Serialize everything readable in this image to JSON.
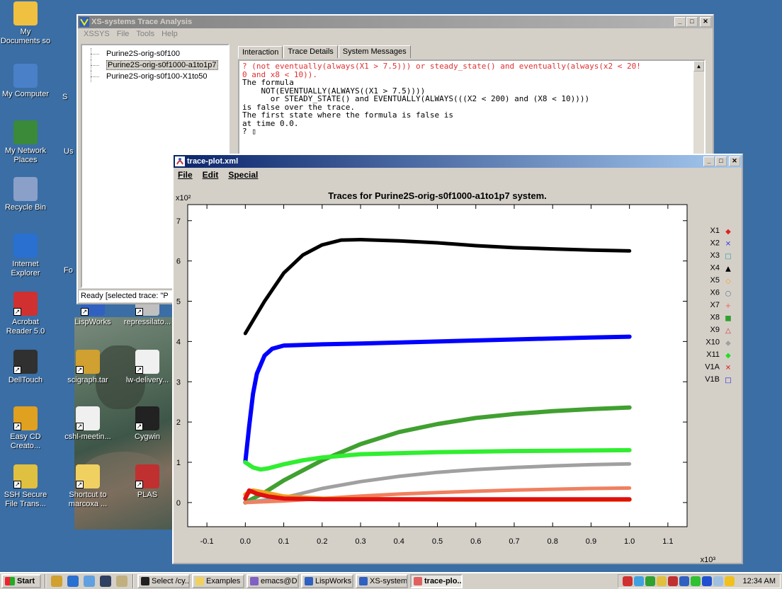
{
  "desktop": {
    "icons": [
      {
        "label": "My Documents so",
        "color": "#f0c040"
      },
      {
        "label": "My Computer",
        "color": "#4a80c8"
      },
      {
        "label": "My Network Places",
        "color": "#3a8a3a"
      },
      {
        "label": "Recycle Bin",
        "color": "#8aa0c8"
      },
      {
        "label": "Internet Explorer",
        "color": "#2a70d0"
      },
      {
        "label": "Acrobat Reader 5.0",
        "color": "#d03030"
      },
      {
        "label": "DellTouch",
        "color": "#303030"
      },
      {
        "label": "Easy CD Creato...",
        "color": "#e0a020"
      },
      {
        "label": "SSH Secure File Trans...",
        "color": "#e0c040"
      },
      {
        "label": "LispWorks",
        "color": "#3060c0"
      },
      {
        "label": "repressilato...",
        "color": "#c0c0c0"
      },
      {
        "label": "scigraph.tar",
        "color": "#d0a030"
      },
      {
        "label": "lw-delivery...",
        "color": "#f0f0f0"
      },
      {
        "label": "cshl-meetin...",
        "color": "#f0f0f0"
      },
      {
        "label": "Cygwin",
        "color": "#222222"
      },
      {
        "label": "Shortcut to marcoxa ...",
        "color": "#f0d060"
      },
      {
        "label": "PLAS",
        "color": "#c03030"
      }
    ],
    "partial_labels": [
      "S",
      "Us",
      "Fo"
    ]
  },
  "xs_window": {
    "title": "XS-systems Trace Analysis",
    "menu": [
      "XSSYS",
      "File",
      "Tools",
      "Help"
    ],
    "traces": [
      "Purine2S-orig-s0f100",
      "Purine2S-orig-s0f1000-a1to1p7",
      "Purine2S-orig-s0f100-X1to50"
    ],
    "selected_index": 1,
    "tabs": [
      "Interaction",
      "Trace Details",
      "System Messages"
    ],
    "active_tab": 0,
    "console_query_lines": [
      "? (not eventually(always(X1 > 7.5))) or steady_state() and eventually(always(x2 < 20!",
      "0 and x8 < 10))."
    ],
    "console_output_lines": [
      "The formula",
      "    NOT(EVENTUALLY(ALWAYS((X1 > 7.5))))",
      "      or STEADY_STATE() and EVENTUALLY(ALWAYS(((X2 < 200) and (X8 < 10))))",
      "is false over the trace.",
      "The first state where the formula is false is",
      "at time 0.0.",
      "? ▯"
    ],
    "status": "Ready [selected trace: \"P"
  },
  "plot_window": {
    "title": "trace-plot.xml",
    "menu": [
      "File",
      "Edit",
      "Special"
    ],
    "y_multiplier": "x10²",
    "x_multiplier": "x10³"
  },
  "chart_data": {
    "type": "line",
    "title": "Traces for Purine2S-orig-s0f1000-a1to1p7 system.",
    "xlabel": "",
    "ylabel": "",
    "xlim": [
      -0.15,
      1.15
    ],
    "ylim": [
      -0.6,
      7.4
    ],
    "x_ticks": [
      "-0.1",
      "0.0",
      "0.1",
      "0.2",
      "0.3",
      "0.4",
      "0.5",
      "0.6",
      "0.7",
      "0.8",
      "0.9",
      "1.0",
      "1.1"
    ],
    "y_ticks": [
      "0",
      "1",
      "2",
      "3",
      "4",
      "5",
      "6",
      "7"
    ],
    "grid": false,
    "legend_position": "right",
    "legend": [
      {
        "name": "X1",
        "color": "#e02020",
        "marker": "◆"
      },
      {
        "name": "X2",
        "color": "#4040e0",
        "marker": "✕"
      },
      {
        "name": "X3",
        "color": "#20a0a0",
        "marker": "□"
      },
      {
        "name": "X4",
        "color": "#000000",
        "marker": "▲"
      },
      {
        "name": "X5",
        "color": "#f0a020",
        "marker": "◇"
      },
      {
        "name": "X6",
        "color": "#607080",
        "marker": "○"
      },
      {
        "name": "X7",
        "color": "#f06060",
        "marker": "+"
      },
      {
        "name": "X8",
        "color": "#30a030",
        "marker": "■"
      },
      {
        "name": "X9",
        "color": "#d03030",
        "marker": "△"
      },
      {
        "name": "X10",
        "color": "#a0a0a0",
        "marker": "◆"
      },
      {
        "name": "X11",
        "color": "#20e020",
        "marker": "◆"
      },
      {
        "name": "V1A",
        "color": "#e02020",
        "marker": "✕"
      },
      {
        "name": "V1B",
        "color": "#2020e0",
        "marker": "□"
      }
    ],
    "series": [
      {
        "color": "#000000",
        "width": 5,
        "x": [
          0.0,
          0.05,
          0.1,
          0.15,
          0.2,
          0.25,
          0.3,
          0.4,
          0.5,
          0.6,
          0.7,
          0.8,
          0.9,
          1.0
        ],
        "y": [
          4.2,
          5.0,
          5.7,
          6.15,
          6.4,
          6.52,
          6.53,
          6.5,
          6.45,
          6.38,
          6.33,
          6.3,
          6.27,
          6.25
        ]
      },
      {
        "color": "#0000ff",
        "width": 6,
        "x": [
          0.0,
          0.01,
          0.02,
          0.03,
          0.05,
          0.07,
          0.1,
          0.2,
          0.3,
          0.5,
          0.7,
          0.9,
          1.0
        ],
        "y": [
          1.0,
          1.9,
          2.7,
          3.2,
          3.65,
          3.82,
          3.9,
          3.93,
          3.95,
          4.0,
          4.05,
          4.1,
          4.12
        ]
      },
      {
        "color": "#40a030",
        "width": 6,
        "x": [
          0.0,
          0.05,
          0.1,
          0.2,
          0.3,
          0.4,
          0.5,
          0.6,
          0.7,
          0.8,
          0.9,
          1.0
        ],
        "y": [
          0.0,
          0.25,
          0.55,
          1.05,
          1.45,
          1.75,
          1.95,
          2.1,
          2.2,
          2.27,
          2.32,
          2.36
        ]
      },
      {
        "color": "#30ee30",
        "width": 6,
        "x": [
          0.0,
          0.02,
          0.04,
          0.06,
          0.1,
          0.15,
          0.2,
          0.3,
          0.5,
          0.7,
          1.0
        ],
        "y": [
          1.0,
          0.87,
          0.82,
          0.85,
          0.95,
          1.05,
          1.12,
          1.2,
          1.25,
          1.28,
          1.3
        ]
      },
      {
        "color": "#a0a0a0",
        "width": 5,
        "x": [
          0.0,
          0.1,
          0.2,
          0.3,
          0.4,
          0.5,
          0.6,
          0.7,
          0.8,
          0.9,
          1.0
        ],
        "y": [
          0.0,
          0.12,
          0.35,
          0.52,
          0.65,
          0.75,
          0.82,
          0.87,
          0.91,
          0.94,
          0.96
        ]
      },
      {
        "color": "#f08060",
        "width": 5,
        "x": [
          0.0,
          0.1,
          0.2,
          0.3,
          0.4,
          0.5,
          0.6,
          0.7,
          0.8,
          0.9,
          1.0
        ],
        "y": [
          0.0,
          0.04,
          0.1,
          0.16,
          0.21,
          0.25,
          0.28,
          0.31,
          0.33,
          0.35,
          0.36
        ]
      },
      {
        "color": "#f0a020",
        "width": 6,
        "x": [
          0.0,
          0.02,
          0.05,
          0.1,
          0.2,
          0.4,
          0.6,
          1.0
        ],
        "y": [
          0.2,
          0.3,
          0.25,
          0.15,
          0.1,
          0.08,
          0.07,
          0.07
        ]
      },
      {
        "color": "#e01010",
        "width": 6,
        "x": [
          0.0,
          0.01,
          0.03,
          0.06,
          0.1,
          0.2,
          0.5,
          1.0
        ],
        "y": [
          0.1,
          0.3,
          0.22,
          0.15,
          0.1,
          0.08,
          0.08,
          0.08
        ]
      }
    ]
  },
  "taskbar": {
    "start_label": "Start",
    "tasks": [
      {
        "label": "Select /cy...",
        "color": "#202020"
      },
      {
        "label": "Examples",
        "color": "#f0d060"
      },
      {
        "label": "emacs@D...",
        "color": "#8060c0"
      },
      {
        "label": "LispWorks...",
        "color": "#3060c0"
      },
      {
        "label": "XS-system...",
        "color": "#3060c0"
      },
      {
        "label": "trace-plo...",
        "color": "#e06060"
      }
    ],
    "active_task": 5,
    "clock": "12:34 AM"
  }
}
